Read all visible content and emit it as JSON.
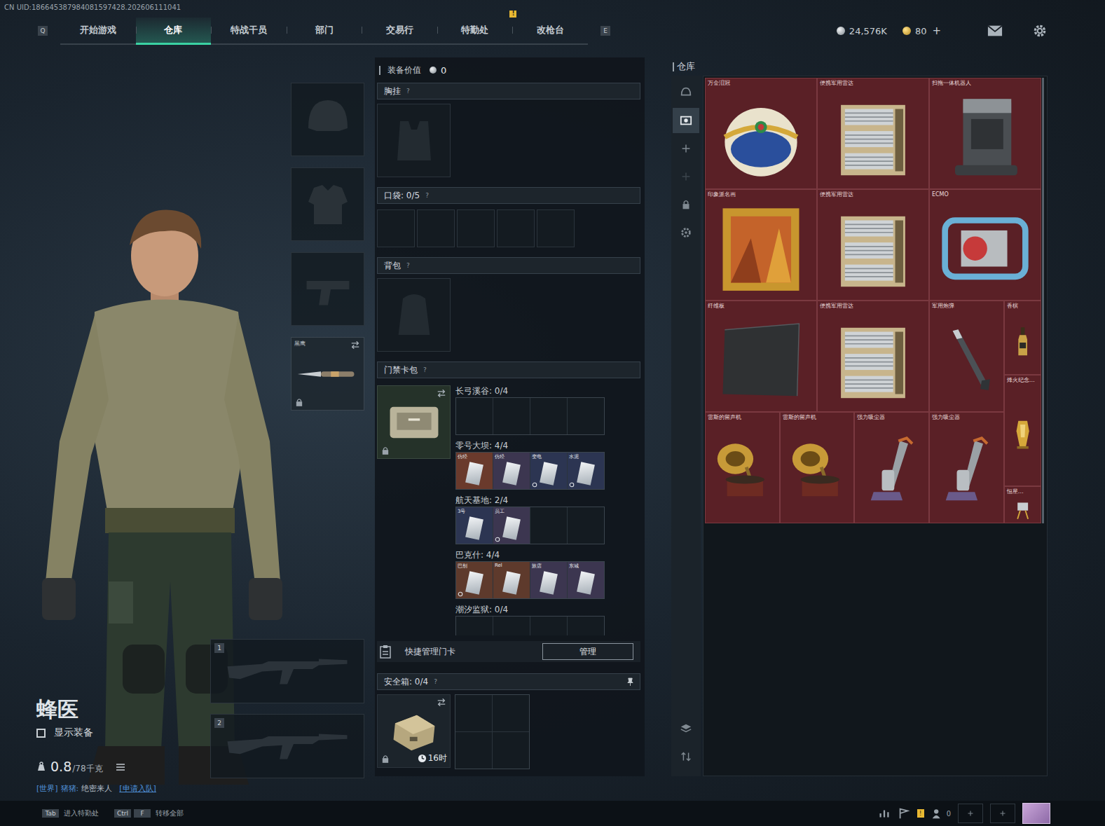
{
  "uid": "CN UID:186645387984081597428.202606111041",
  "nav": {
    "left_key": "Q",
    "right_key": "E",
    "tabs": [
      {
        "label": "开始游戏",
        "selected": false,
        "badge": ""
      },
      {
        "label": "仓库",
        "selected": true,
        "badge": ""
      },
      {
        "label": "特战干员",
        "selected": false,
        "badge": ""
      },
      {
        "label": "部门",
        "selected": false,
        "badge": ""
      },
      {
        "label": "交易行",
        "selected": false,
        "badge": ""
      },
      {
        "label": "特勤处",
        "selected": false,
        "badge": "!"
      },
      {
        "label": "改枪台",
        "selected": false,
        "badge": ""
      }
    ]
  },
  "currency": {
    "coins": "24,576K",
    "tokens": "80",
    "add": "+"
  },
  "operator": {
    "name": "蜂医",
    "show_gear": {
      "label": "显示装备",
      "checked": false
    },
    "weight": "0.8",
    "weight_max": "/78千克"
  },
  "chat": {
    "channel": "[世界]",
    "sender": "猪猪:",
    "message": "绝密来人",
    "action": "[申请入队]"
  },
  "equip_slots": [
    {
      "label": "",
      "filled": false,
      "locked": false
    },
    {
      "label": "",
      "filled": false,
      "locked": false
    },
    {
      "label": "",
      "filled": false,
      "locked": false
    },
    {
      "label": "黑鹰",
      "filled": true,
      "locked": true
    }
  ],
  "weapon_slots": [
    {
      "number": "1",
      "filled": false
    },
    {
      "number": "2",
      "filled": false
    }
  ],
  "loadout": {
    "value_label": "装备价值",
    "value": "0",
    "help": "?",
    "chest": "胸挂",
    "pocket": "口袋:",
    "pocket_count": "0/5",
    "pocket_slots": [
      {
        "filled": false
      },
      {
        "filled": false
      },
      {
        "filled": false
      },
      {
        "filled": false
      },
      {
        "filled": false
      }
    ],
    "backpack": "背包"
  },
  "keycards": {
    "title": "门禁卡包",
    "locked": true,
    "groups": [
      {
        "map": "长弓溪谷:",
        "count": "0/4",
        "cards": []
      },
      {
        "map": "零号大坝:",
        "count": "4/4",
        "cards": [
          {
            "name": "仿经",
            "bound": false,
            "color": "#6a3a2c"
          },
          {
            "name": "仿经",
            "bound": false,
            "color": "#3c3650"
          },
          {
            "name": "变电",
            "bound": true,
            "color": "#2c3552"
          },
          {
            "name": "水泥",
            "bound": true,
            "color": "#2c3552"
          }
        ]
      },
      {
        "map": "航天基地:",
        "count": "2/4",
        "cards": [
          {
            "name": "3号",
            "bound": false,
            "color": "#2c3552"
          },
          {
            "name": "员工",
            "bound": true,
            "color": "#3c3650"
          }
        ]
      },
      {
        "map": "巴克什:",
        "count": "4/4",
        "cards": [
          {
            "name": "巴别",
            "bound": true,
            "color": "#5e3a2c"
          },
          {
            "name": "Rel",
            "bound": false,
            "color": "#5e3a2c"
          },
          {
            "name": "旅店",
            "bound": false,
            "color": "#3c3650"
          },
          {
            "name": "东城",
            "bound": false,
            "color": "#3c3650"
          }
        ]
      },
      {
        "map": "潮汐监狱:",
        "count": "0/4",
        "cards": []
      }
    ]
  },
  "quick_manage": {
    "label": "快捷管理门卡",
    "button": "管理"
  },
  "safebox": {
    "label": "安全箱:",
    "count": "0/4",
    "help": "?",
    "timer": "16时",
    "locked": true
  },
  "warehouse": {
    "title": "仓库",
    "sidebar": [
      {
        "selected": false,
        "disabled": false
      },
      {
        "selected": true,
        "disabled": false
      },
      {
        "selected": false,
        "disabled": false
      },
      {
        "selected": false,
        "disabled": true
      },
      {
        "selected": false,
        "disabled": false
      },
      {
        "selected": false,
        "disabled": false
      }
    ],
    "items": [
      {
        "name": "万金泪冠"
      },
      {
        "name": "便携军用雷达"
      },
      {
        "name": "扫拖一体机器人"
      },
      {
        "name": "印象派名画"
      },
      {
        "name": "便携军用雷达"
      },
      {
        "name": "ECMO"
      },
      {
        "name": "纤维板"
      },
      {
        "name": "便携军用雷达"
      },
      {
        "name": "军用炮弹"
      },
      {
        "name": "香槟"
      },
      {
        "name": "烽火纪念…"
      },
      {
        "name": "雷斯的留声机"
      },
      {
        "name": "雷斯的留声机"
      },
      {
        "name": "强力吸尘器"
      },
      {
        "name": "强力吸尘器"
      },
      {
        "name": "恒星…"
      }
    ]
  },
  "hints": [
    {
      "keys": [
        "Tab"
      ],
      "label": "进入特勤处"
    },
    {
      "keys": [
        "Ctrl",
        "F"
      ],
      "label": "转移全部"
    }
  ],
  "social": {
    "friends": "0",
    "badge": "!"
  }
}
